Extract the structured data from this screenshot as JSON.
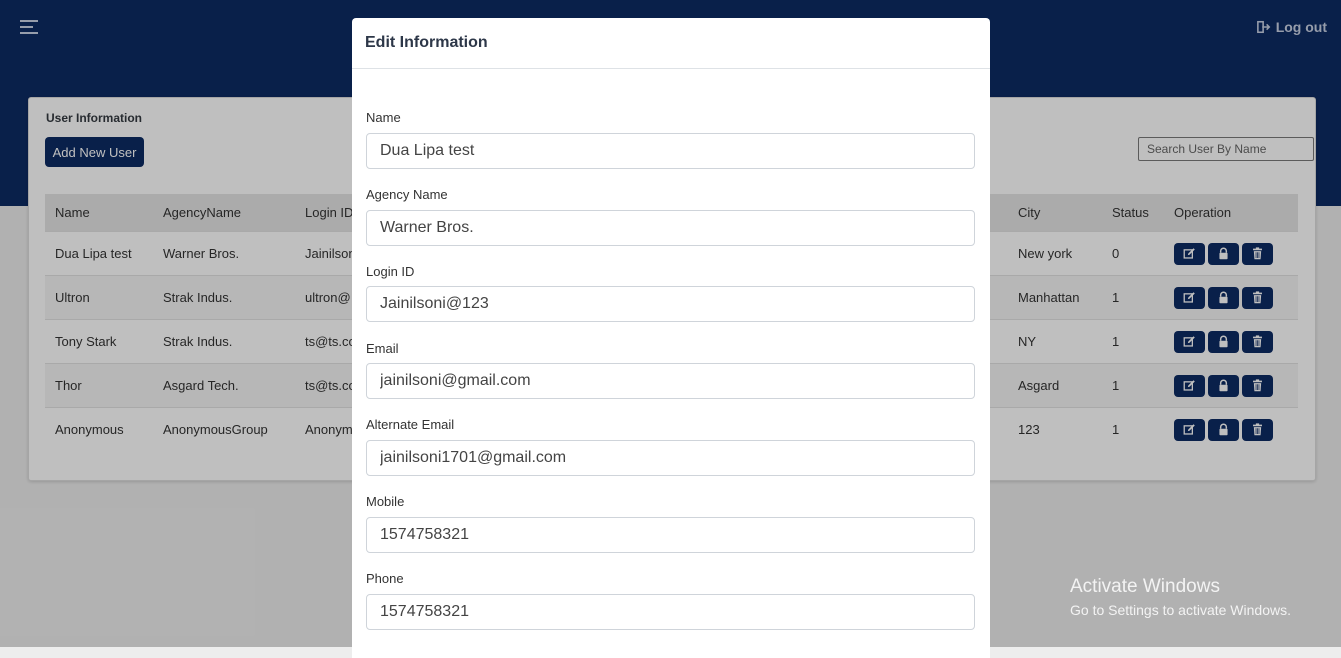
{
  "topbar": {
    "logout_label": "Log out"
  },
  "card": {
    "title": "User Information",
    "add_button": "Add New User",
    "search_placeholder": "Search User By Name"
  },
  "table": {
    "headers": [
      "Name",
      "AgencyName",
      "Login ID",
      "City",
      "Status",
      "Operation"
    ],
    "rows": [
      {
        "name": "Dua Lipa test",
        "agency": "Warner Bros.",
        "login": "Jainilson",
        "city": "New york",
        "status": "0"
      },
      {
        "name": "Ultron",
        "agency": "Strak Indus.",
        "login": "ultron@",
        "city": "Manhattan",
        "status": "1"
      },
      {
        "name": "Tony Stark",
        "agency": "Strak Indus.",
        "login": "ts@ts.co",
        "city": "NY",
        "status": "1"
      },
      {
        "name": "Thor",
        "agency": "Asgard Tech.",
        "login": "ts@ts.co",
        "city": "Asgard",
        "status": "1"
      },
      {
        "name": "Anonymous",
        "agency": "AnonymousGroup",
        "login": "Anonym",
        "city": "123",
        "status": "1"
      }
    ],
    "operation_icons": [
      "edit-icon",
      "lock-icon",
      "trash-icon"
    ]
  },
  "modal": {
    "title": "Edit Information",
    "fields": [
      {
        "label": "Name",
        "value": "Dua Lipa test"
      },
      {
        "label": "Agency Name",
        "value": "Warner Bros."
      },
      {
        "label": "Login ID",
        "value": "Jainilsoni@123"
      },
      {
        "label": "Email",
        "value": "jainilsoni@gmail.com"
      },
      {
        "label": "Alternate Email",
        "value": "jainilsoni1701@gmail.com"
      },
      {
        "label": "Mobile",
        "value": "1574758321"
      },
      {
        "label": "Phone",
        "value": "1574758321"
      }
    ]
  },
  "watermark": {
    "line1": "Activate Windows",
    "line2": "Go to Settings to activate Windows."
  },
  "colors": {
    "primary": "#0d2b63",
    "background": "#ededed"
  }
}
